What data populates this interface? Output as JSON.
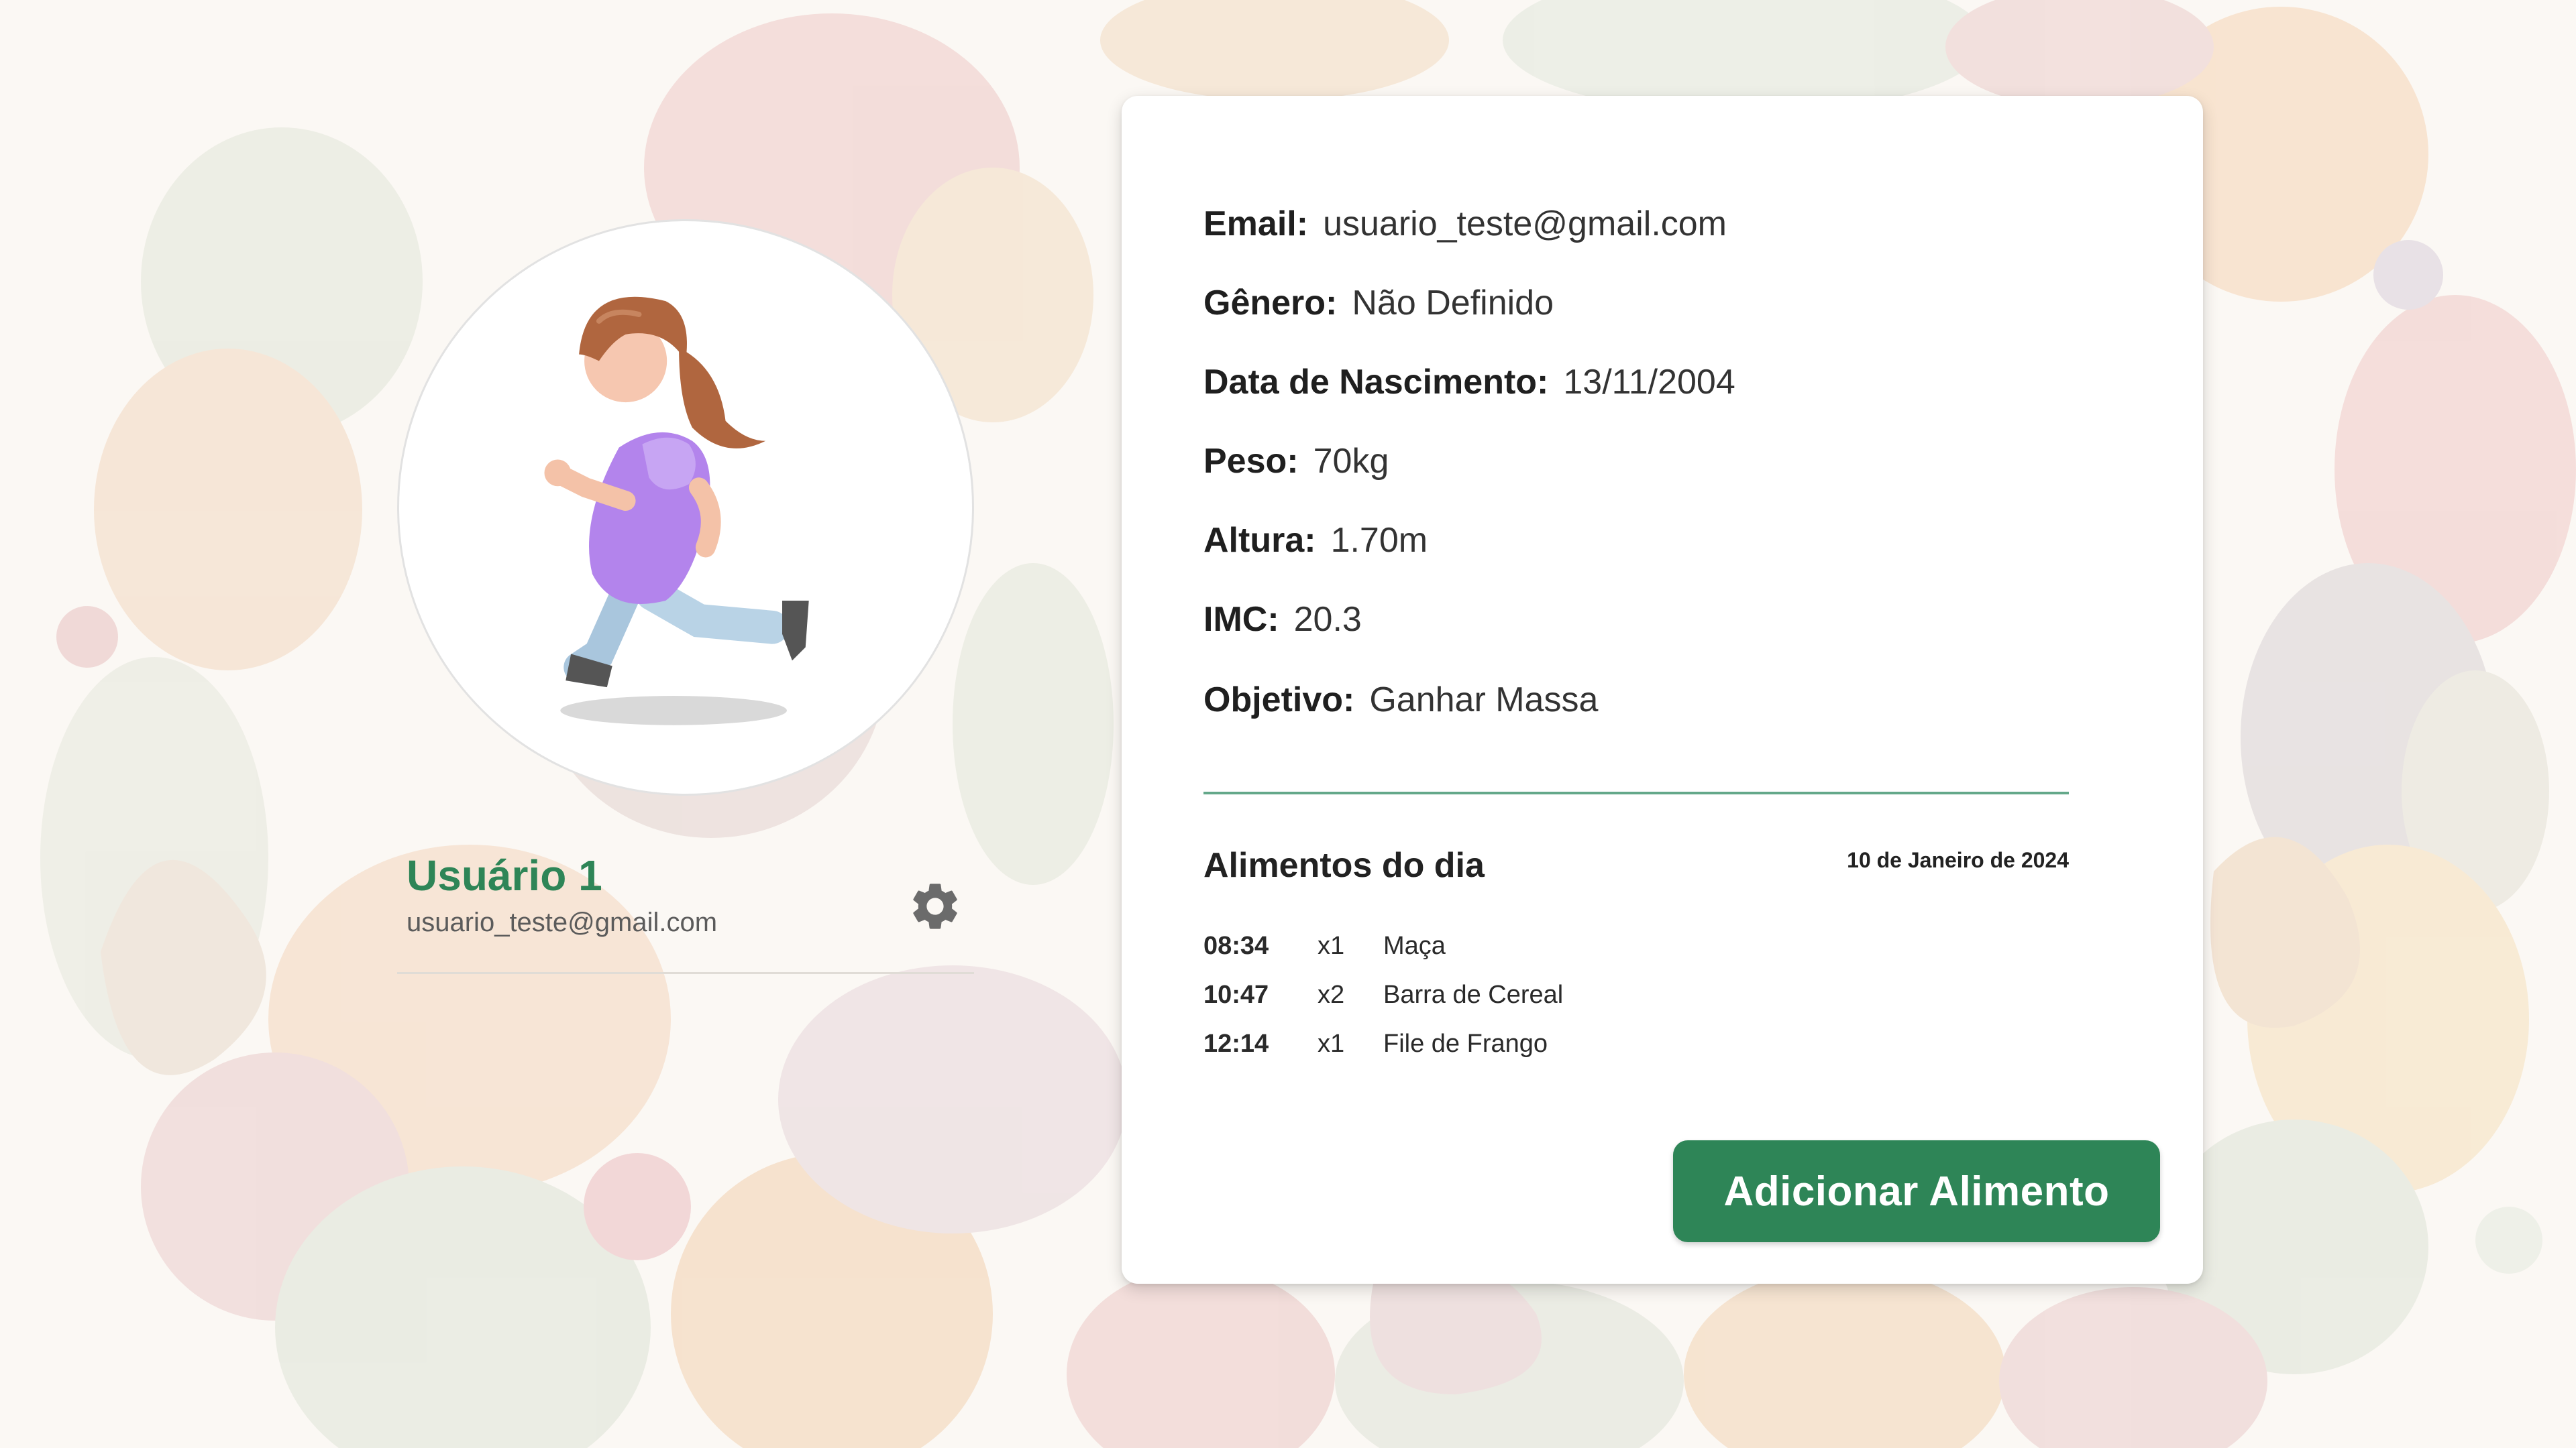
{
  "profile": {
    "name": "Usuário 1",
    "email": "usuario_teste@gmail.com"
  },
  "info": {
    "email": {
      "label": "Email:",
      "value": "usuario_teste@gmail.com"
    },
    "gender": {
      "label": "Gênero:",
      "value": "Não Definido"
    },
    "birthdate": {
      "label": "Data de Nascimento:",
      "value": "13/11/2004"
    },
    "weight": {
      "label": "Peso:",
      "value": "70kg"
    },
    "height": {
      "label": "Altura:",
      "value": "1.70m"
    },
    "bmi": {
      "label": "IMC:",
      "value": "20.3"
    },
    "goal": {
      "label": "Objetivo:",
      "value": "Ganhar Massa"
    }
  },
  "foods": {
    "title": "Alimentos do dia",
    "date": "10 de Janeiro de 2024",
    "items": [
      {
        "time": "08:34",
        "qty": "x1",
        "name": "Maça"
      },
      {
        "time": "10:47",
        "qty": "x2",
        "name": "Barra de Cereal"
      },
      {
        "time": "12:14",
        "qty": "x1",
        "name": "File de Frango"
      }
    ]
  },
  "actions": {
    "add_food": "Adicionar Alimento"
  },
  "colors": {
    "accent": "#2e8557",
    "divider": "#64a88a",
    "background": "#fbf8f4",
    "avatar_shirt": "#b384ec",
    "avatar_hair": "#b0663f"
  },
  "icons": {
    "settings": "gear-icon",
    "avatar": "running-person-illustration",
    "background": "fruits-vegetables-pattern"
  }
}
